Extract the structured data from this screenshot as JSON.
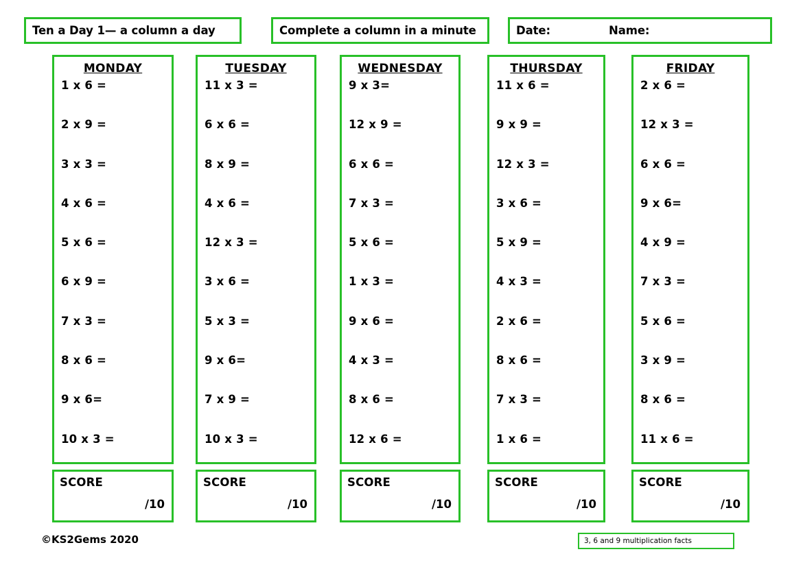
{
  "theme": {
    "accent_green": "#28C028",
    "text_color": "#000000",
    "page_background": "#FFFFFF"
  },
  "header": {
    "title": "Ten a Day 1— a column a day",
    "subtitle": "Complete a column in a minute",
    "date_label": "Date:",
    "name_label": "Name:"
  },
  "columns": [
    {
      "day": "MONDAY",
      "questions": [
        "1 x 6 =",
        "2 x 9 =",
        "3 x 3 =",
        "4 x 6 =",
        "5 x 6 =",
        "6 x 9 =",
        "7 x 3 =",
        "8 x 6 =",
        "9 x 6=",
        "10 x 3 ="
      ],
      "score_label": "SCORE",
      "score_out_of": "/10"
    },
    {
      "day": "TUESDAY",
      "questions": [
        "11 x 3 =",
        "6 x 6 =",
        "8 x 9 =",
        "4 x 6 =",
        "12 x 3 =",
        "3 x 6 =",
        "5 x 3 =",
        "9 x 6=",
        "7 x 9 =",
        "10 x 3 ="
      ],
      "score_label": "SCORE",
      "score_out_of": "/10"
    },
    {
      "day": "WEDNESDAY",
      "questions": [
        "9 x 3=",
        "12 x 9 =",
        "6 x 6 =",
        "7 x 3 =",
        "5 x 6 =",
        "1 x 3 =",
        "9 x 6 =",
        "4 x 3 =",
        "8 x 6 =",
        "12 x 6 ="
      ],
      "score_label": "SCORE",
      "score_out_of": "/10"
    },
    {
      "day": "THURSDAY",
      "questions": [
        "11 x 6 =",
        "9 x 9 =",
        "12 x 3 =",
        "3 x 6 =",
        "5 x 9 =",
        "4 x 3 =",
        "2 x 6 =",
        "8 x 6 =",
        "7 x 3 =",
        "1 x 6 ="
      ],
      "score_label": "SCORE",
      "score_out_of": "/10"
    },
    {
      "day": "FRIDAY",
      "questions": [
        "2 x 6 =",
        "12 x 3 =",
        "6 x 6 =",
        "9 x 6=",
        "4 x 9 =",
        "7 x 3 =",
        "5 x 6 =",
        "3 x 9 =",
        "8 x 6 =",
        "11 x 6 ="
      ],
      "score_label": "SCORE",
      "score_out_of": "/10"
    }
  ],
  "footer": {
    "copyright": "©KS2Gems 2020",
    "facts_note": "3, 6 and 9 multiplication facts"
  }
}
